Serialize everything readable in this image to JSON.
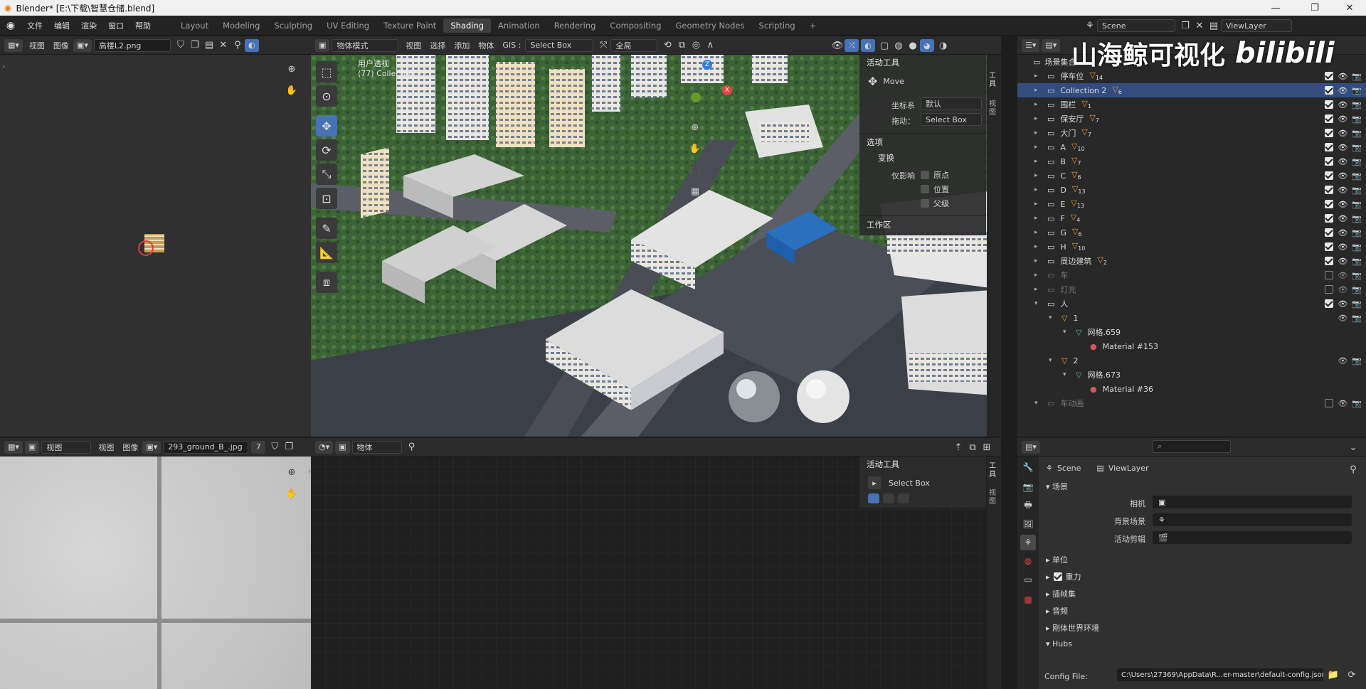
{
  "window": {
    "title": "Blender* [E:\\下载\\智慧仓储.blend]",
    "min": "—",
    "max": "❐",
    "close": "✕"
  },
  "menu": [
    "文件",
    "编辑",
    "渲染",
    "窗口",
    "帮助"
  ],
  "workspaces": [
    "Layout",
    "Modeling",
    "Sculpting",
    "UV Editing",
    "Texture Paint",
    "Shading",
    "Animation",
    "Rendering",
    "Compositing",
    "Geometry Nodes",
    "Scripting",
    "+"
  ],
  "scene": {
    "name": "Scene",
    "view_layer": "ViewLayer"
  },
  "watermark": {
    "text": "山海鲸可视化",
    "logo": "bilibili"
  },
  "image_editor_top": {
    "menus": [
      "视图",
      "图像"
    ],
    "image_name": "高楼L2.png"
  },
  "viewport": {
    "mode": "物体模式",
    "menus": [
      "视图",
      "选择",
      "添加",
      "物体",
      "GIS :"
    ],
    "select_tool": "Select Box",
    "orientation": "全局",
    "overlay_title": "用户透视",
    "overlay_sub": "(77) Collection 2"
  },
  "tool_panel": {
    "title": "活动工具",
    "tool": "Move",
    "coord_label": "坐标系",
    "coord_value": "默认",
    "drag_label": "拖动：",
    "drag_value": "Select Box",
    "options_title": "选项",
    "transform_title": "变换",
    "affect_label": "仅影响",
    "affect_items": [
      "原点",
      "位置",
      "父级"
    ],
    "workspace_title": "工作区",
    "tabs": [
      "工具",
      "视图"
    ]
  },
  "outliner": {
    "root": "场景集合",
    "items": [
      {
        "label": "停车位",
        "count": "14"
      },
      {
        "label": "Collection 2",
        "count": "6",
        "selected": true
      },
      {
        "label": "围栏",
        "count": "1"
      },
      {
        "label": "保安厅",
        "count": "7"
      },
      {
        "label": "大门",
        "count": "7"
      },
      {
        "label": "A",
        "count": "10"
      },
      {
        "label": "B",
        "count": "7"
      },
      {
        "label": "C",
        "count": "6"
      },
      {
        "label": "D",
        "count": "13"
      },
      {
        "label": "E",
        "count": "13"
      },
      {
        "label": "F",
        "count": "4"
      },
      {
        "label": "G",
        "count": "6"
      },
      {
        "label": "H",
        "count": "10"
      },
      {
        "label": "周边建筑",
        "count": "2"
      },
      {
        "label": "车",
        "dim": true
      },
      {
        "label": "灯光",
        "dim": true
      },
      {
        "label": "人"
      }
    ],
    "person_children": [
      {
        "label": "1",
        "indent": 1,
        "kind": "empty"
      },
      {
        "label": "网格.659",
        "indent": 2,
        "kind": "mesh"
      },
      {
        "label": "Material #153",
        "indent": 3,
        "kind": "mat"
      },
      {
        "label": "2",
        "indent": 1,
        "kind": "empty"
      },
      {
        "label": "网格.673",
        "indent": 2,
        "kind": "mesh"
      },
      {
        "label": "Material #36",
        "indent": 3,
        "kind": "mat"
      },
      {
        "label": "车动画",
        "indent": 0,
        "kind": "coll",
        "dim": true
      }
    ]
  },
  "image_editor_bottom": {
    "menus": [
      "视图",
      "图像"
    ],
    "view_dd": "视图",
    "image_name": "293_ground_B_.jpg",
    "users": "7"
  },
  "node_editor": {
    "mode": "物体",
    "tool_title": "活动工具",
    "tool": "Select Box",
    "tabs": [
      "工具",
      "视图"
    ]
  },
  "properties": {
    "search_placeholder": "",
    "crumb_scene": "Scene",
    "crumb_layer": "ViewLayer",
    "scene_section": "场景",
    "camera_label": "相机",
    "bg_label": "背景场景",
    "clip_label": "活动剪辑",
    "sections": [
      "单位",
      "重力",
      "插帧集",
      "音频",
      "刚体世界环境"
    ],
    "hubs": "Hubs",
    "config_label": "Config File:",
    "config_value": "C:\\Users\\27369\\AppData\\R...er-master\\default-config.json"
  }
}
